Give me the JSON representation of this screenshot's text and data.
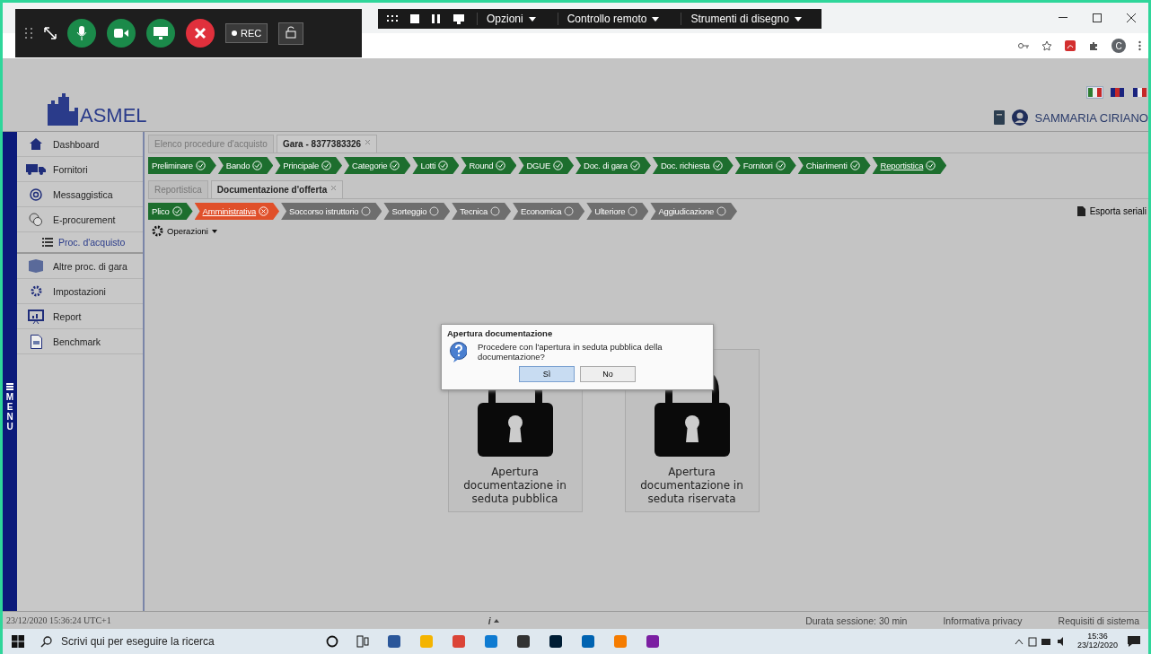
{
  "recording_toolbar": {
    "rec_label": "REC"
  },
  "share_toolbar": {
    "menus": [
      "Opzioni",
      "Controllo remoto",
      "Strumenti di disegno"
    ]
  },
  "browser": {
    "profile_letter": "C"
  },
  "header": {
    "logo_text": "ASMEL",
    "languages": [
      {
        "selected": true
      },
      {
        "selected": false
      },
      {
        "selected": false
      }
    ],
    "user_name": "SAMMARIA CIRIANO"
  },
  "sidebar": {
    "menu_label": "MENU",
    "items": [
      {
        "label": "Dashboard"
      },
      {
        "label": "Fornitori"
      },
      {
        "label": "Messaggistica"
      },
      {
        "label": "E-procurement",
        "children": [
          {
            "label": "Proc. d'acquisto"
          }
        ]
      },
      {
        "label": "Altre proc. di gara"
      },
      {
        "label": "Impostazioni"
      },
      {
        "label": "Report"
      },
      {
        "label": "Benchmark"
      }
    ]
  },
  "tabs": [
    {
      "label": "Elenco procedure d'acquisto",
      "selected": false,
      "closable": false
    },
    {
      "label": "Gara - 8377383326",
      "selected": true,
      "closable": true
    }
  ],
  "steps": [
    {
      "label": "Preliminare",
      "kind": "done",
      "current": false
    },
    {
      "label": "Bando",
      "kind": "done",
      "current": false
    },
    {
      "label": "Principale",
      "kind": "done",
      "current": false
    },
    {
      "label": "Categorie",
      "kind": "done",
      "current": false
    },
    {
      "label": "Lotti",
      "kind": "done",
      "current": false
    },
    {
      "label": "Round",
      "kind": "done",
      "current": false
    },
    {
      "label": "DGUE",
      "kind": "done",
      "current": false
    },
    {
      "label": "Doc. di gara",
      "kind": "done",
      "current": false
    },
    {
      "label": "Doc. richiesta",
      "kind": "done",
      "current": false
    },
    {
      "label": "Fornitori",
      "kind": "done",
      "current": false
    },
    {
      "label": "Chiarimenti",
      "kind": "done",
      "current": false
    },
    {
      "label": "Reportistica",
      "kind": "done",
      "current": true
    }
  ],
  "subtabs": [
    {
      "label": "Reportistica",
      "selected": false,
      "closable": false
    },
    {
      "label": "Documentazione d'offerta",
      "selected": true,
      "closable": true
    }
  ],
  "substeps": [
    {
      "label": "Plico",
      "kind": "done",
      "current": false
    },
    {
      "label": "Amministrativa",
      "kind": "error",
      "current": true
    },
    {
      "label": "Soccorso istruttorio",
      "kind": "pending",
      "current": false
    },
    {
      "label": "Sorteggio",
      "kind": "pending",
      "current": false
    },
    {
      "label": "Tecnica",
      "kind": "pending",
      "current": false
    },
    {
      "label": "Economica",
      "kind": "pending",
      "current": false
    },
    {
      "label": "Ulteriore",
      "kind": "pending",
      "current": false
    },
    {
      "label": "Aggiudicazione",
      "kind": "pending",
      "current": false
    }
  ],
  "toolbar": {
    "operations": "Operazioni",
    "export": "Esporta seriali"
  },
  "cards": [
    {
      "label": "Apertura documentazione in seduta pubblica"
    },
    {
      "label": "Apertura documentazione in seduta riservata"
    }
  ],
  "dialog": {
    "title": "Apertura documentazione",
    "message": "Procedere con l'apertura in seduta pubblica della documentazione?",
    "buttons": [
      {
        "label": "Sì",
        "focused": true
      },
      {
        "label": "No",
        "focused": false
      }
    ]
  },
  "status_bar": {
    "datetime": "23/12/2020 15:36:24 UTC+1",
    "info": "i",
    "session": "Durata sessione: 30 min",
    "privacy": "Informativa privacy",
    "requirements": "Requisiti di sistema"
  },
  "taskbar": {
    "search_placeholder": "Scrivi qui per eseguire la ricerca",
    "time": "15:36",
    "date": "23/12/2020"
  }
}
